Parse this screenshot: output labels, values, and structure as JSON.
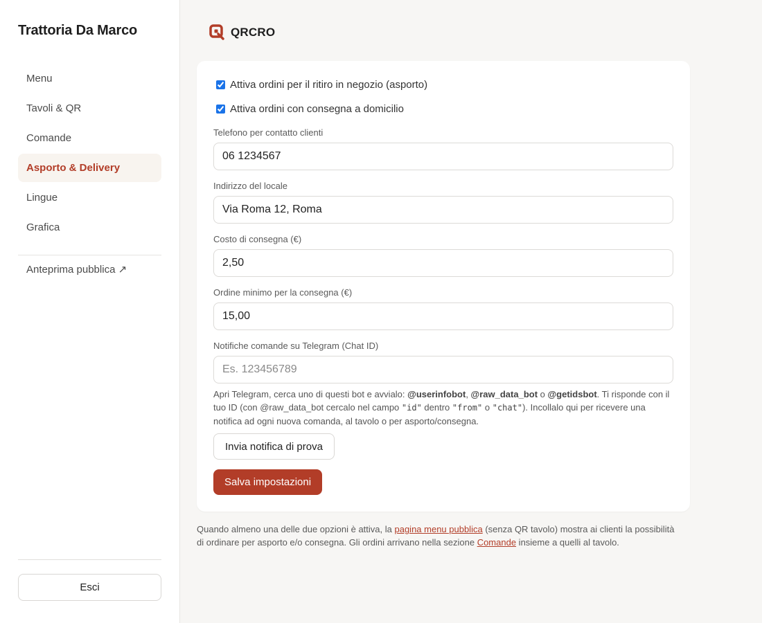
{
  "app": {
    "restaurant_name": "Trattoria Da Marco",
    "logo_text": "QRCRO",
    "accent_color": "#b23d28"
  },
  "sidebar": {
    "items": [
      {
        "label": "Menu"
      },
      {
        "label": "Tavoli & QR"
      },
      {
        "label": "Comande"
      },
      {
        "label": "Asporto & Delivery"
      },
      {
        "label": "Lingue"
      },
      {
        "label": "Grafica"
      }
    ],
    "preview_label": "Anteprima pubblica ↗",
    "logout_label": "Esci"
  },
  "form": {
    "pickup_label": "Attiva ordini per il ritiro in negozio (asporto)",
    "pickup_checked": true,
    "delivery_label": "Attiva ordini con consegna a domicilio",
    "delivery_checked": true,
    "phone_label": "Telefono per contatto clienti",
    "phone_value": "06 1234567",
    "address_label": "Indirizzo del locale",
    "address_value": "Via Roma 12, Roma",
    "delivery_cost_label": "Costo di consegna (€)",
    "delivery_cost_value": "2,50",
    "min_order_label": "Ordine minimo per la consegna (€)",
    "min_order_value": "15,00",
    "telegram_label": "Notifiche comande su Telegram (Chat ID)",
    "telegram_value": "",
    "telegram_placeholder": "Es. 123456789",
    "help": {
      "p1": "Apri Telegram, cerca uno di questi bot e avvialo: ",
      "bot1": "@userinfobot",
      "sep1": ", ",
      "bot2": "@raw_data_bot",
      "sep2": " o ",
      "bot3": "@getidsbot",
      "p2": ". Ti risponde con il tuo ID (con @raw_data_bot cercalo nel campo ",
      "code1": "\"id\"",
      "p3": " dentro ",
      "code2": "\"from\"",
      "p4": " o ",
      "code3": "\"chat\"",
      "p5": "). Incollalo qui per ricevere una notifica ad ogni nuova comanda, al tavolo o per asporto/consegna."
    },
    "test_button_label": "Invia notifica di prova",
    "save_button_label": "Salva impostazioni"
  },
  "footnote": {
    "t1": "Quando almeno una delle due opzioni è attiva, la ",
    "link1": "pagina menu pubblica",
    "t2": " (senza QR tavolo) mostra ai clienti la possibilità di ordinare per asporto e/o consegna. Gli ordini arrivano nella sezione ",
    "link2": "Comande",
    "t3": " insieme a quelli al tavolo."
  }
}
